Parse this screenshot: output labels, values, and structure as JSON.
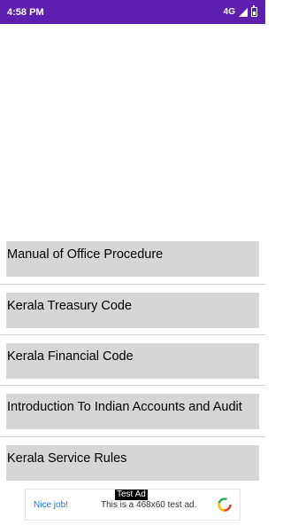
{
  "status_bar": {
    "time": "4:58 PM",
    "network": "4G",
    "icons": [
      "signal-icon",
      "battery-icon"
    ]
  },
  "menu": {
    "items": [
      {
        "label": "Manual of Office Procedure"
      },
      {
        "label": "Kerala Treasury Code"
      },
      {
        "label": "Kerala Financial Code"
      },
      {
        "label": "Introduction To Indian Accounts and Audit"
      },
      {
        "label": "Kerala Service Rules"
      }
    ]
  },
  "ad": {
    "tag": "Test Ad",
    "cta": "Nice job!",
    "text": "This is a 468x60 test ad."
  },
  "colors": {
    "status_bar": "#5c1fb0",
    "item_background": "#d6d6d6",
    "ad_cta": "#1a73e8"
  }
}
